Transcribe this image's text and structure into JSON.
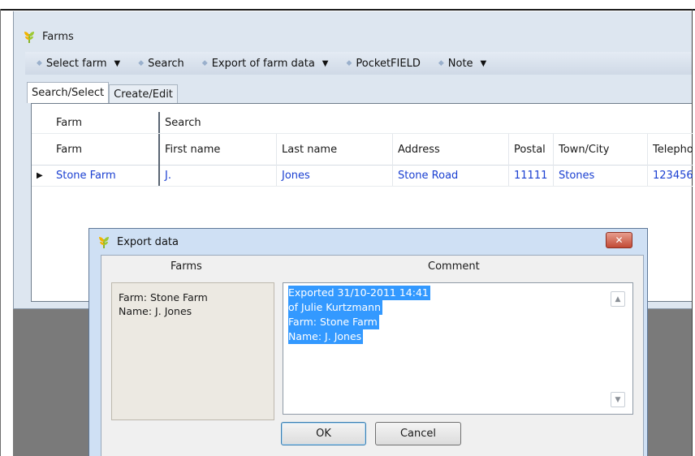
{
  "app": {
    "title": "Farms",
    "icon": "wheat-icon"
  },
  "toolbar": {
    "items": [
      {
        "label": "Select farm",
        "has_dropdown": true
      },
      {
        "label": "Search",
        "has_dropdown": false
      },
      {
        "label": "Export of farm data",
        "has_dropdown": true
      },
      {
        "label": "PocketFIELD",
        "has_dropdown": false
      },
      {
        "label": "Note",
        "has_dropdown": true
      }
    ]
  },
  "tabs": [
    {
      "label": "Search/Select",
      "active": true
    },
    {
      "label": "Create/Edit",
      "active": false
    }
  ],
  "grid": {
    "band": {
      "farm": "Farm",
      "search": "Search"
    },
    "columns": [
      "Farm",
      "First name",
      "Last name",
      "Address",
      "Postal",
      "Town/City",
      "Telepho"
    ],
    "rows": [
      [
        "Stone Farm",
        "J.",
        "Jones",
        "Stone Road",
        "11111",
        "Stones",
        "123456"
      ]
    ]
  },
  "dialog": {
    "title": "Export data",
    "close_label": "✕",
    "farms_header": "Farms",
    "comment_header": "Comment",
    "farms_lines": [
      "Farm: Stone Farm",
      "Name: J. Jones"
    ],
    "comment_lines": [
      "Exported 31/10-2011 14:41",
      "of Julie Kurtzmann",
      "Farm: Stone Farm",
      "Name: J. Jones"
    ],
    "ok_label": "OK",
    "cancel_label": "Cancel"
  },
  "colors": {
    "accent_link": "#1a3fd1",
    "selection": "#3399ff",
    "close_button": "#c24a35",
    "window_bg": "#dde6f0"
  }
}
